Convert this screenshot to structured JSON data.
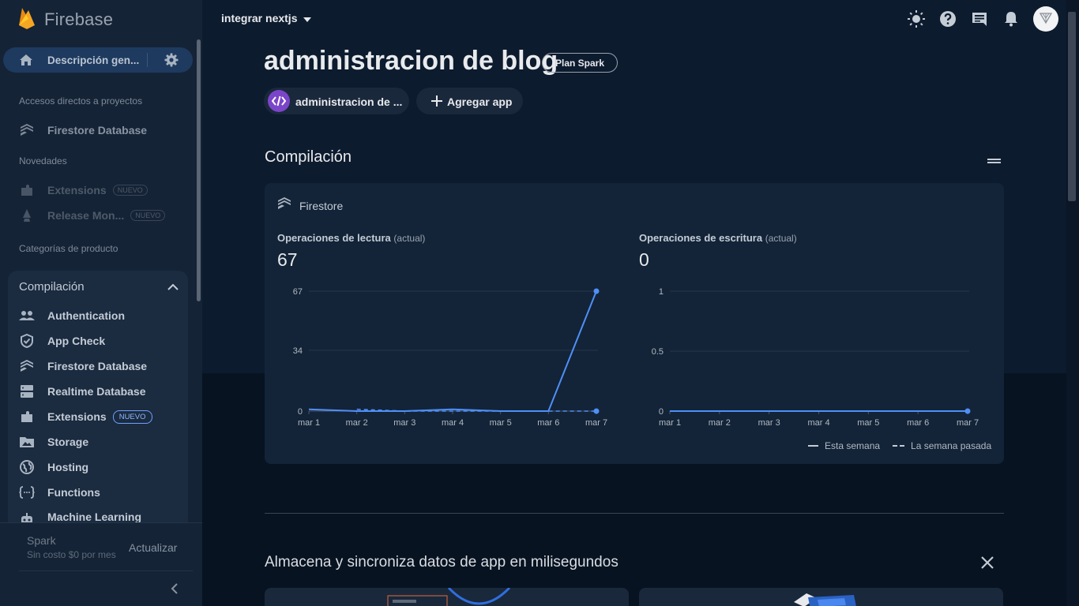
{
  "brand": {
    "name": "Firebase"
  },
  "sidebar": {
    "overview_label": "Descripción gen...",
    "shortcuts_title": "Accesos directos a proyectos",
    "shortcut_item": "Firestore Database",
    "novedades_title": "Novedades",
    "novedades": [
      {
        "label": "Extensions",
        "badge": "NUEVO"
      },
      {
        "label": "Release Mon...",
        "badge": "NUEVO"
      }
    ],
    "categories_title": "Categorías de producto",
    "build_title": "Compilación",
    "build_items": [
      {
        "label": "Authentication",
        "icon": "people-icon"
      },
      {
        "label": "App Check",
        "icon": "shield-icon"
      },
      {
        "label": "Firestore Database",
        "icon": "firestore-icon"
      },
      {
        "label": "Realtime Database",
        "icon": "database-icon"
      },
      {
        "label": "Extensions",
        "icon": "extensions-icon",
        "badge": "NUEVO"
      },
      {
        "label": "Storage",
        "icon": "storage-icon"
      },
      {
        "label": "Hosting",
        "icon": "globe-icon"
      },
      {
        "label": "Functions",
        "icon": "functions-icon"
      },
      {
        "label": "Machine Learning",
        "icon": "robot-icon"
      }
    ],
    "plan": {
      "name": "Spark",
      "subtitle": "Sin costo $0 por mes",
      "upgrade": "Actualizar"
    }
  },
  "topbar": {
    "project": "integrar nextjs"
  },
  "main": {
    "title": "administracion de blog",
    "plan_chip": "Plan Spark",
    "app_chip": "administracion de ...",
    "add_app": "Agregar app",
    "section_title": "Compilación",
    "card_title": "Firestore",
    "reads": {
      "label": "Operaciones de lectura",
      "suffix": "(actual)",
      "value": "67"
    },
    "writes": {
      "label": "Operaciones de escritura",
      "suffix": "(actual)",
      "value": "0"
    },
    "legend": {
      "this_week": "Esta semana",
      "last_week": "La semana pasada"
    },
    "bottom_title": "Almacena y sincroniza datos de app en milisegundos"
  },
  "colors": {
    "accent": "#4f8ff7",
    "sidebar_bg": "#142336",
    "card_bg": "#132438",
    "purple": "#7b45c9"
  },
  "chart_data": [
    {
      "type": "line",
      "title": "Operaciones de lectura",
      "x": [
        "mar 1",
        "mar 2",
        "mar 3",
        "mar 4",
        "mar 5",
        "mar 6",
        "mar 7"
      ],
      "yticks": [
        "0",
        "34",
        "67"
      ],
      "ylim": [
        0,
        67
      ],
      "series": [
        {
          "name": "Esta semana",
          "values": [
            1,
            0,
            0,
            1,
            0,
            0,
            67
          ]
        },
        {
          "name": "La semana pasada",
          "values": [
            null,
            1,
            0,
            0,
            0,
            0,
            0
          ]
        }
      ],
      "legend": "bottom-right"
    },
    {
      "type": "line",
      "title": "Operaciones de escritura",
      "x": [
        "mar 1",
        "mar 2",
        "mar 3",
        "mar 4",
        "mar 5",
        "mar 6",
        "mar 7"
      ],
      "yticks": [
        "0",
        "0.5",
        "1"
      ],
      "ylim": [
        0,
        1
      ],
      "series": [
        {
          "name": "Esta semana",
          "values": [
            0,
            0,
            0,
            0,
            0,
            0,
            0
          ]
        }
      ],
      "legend": "bottom-right"
    }
  ]
}
